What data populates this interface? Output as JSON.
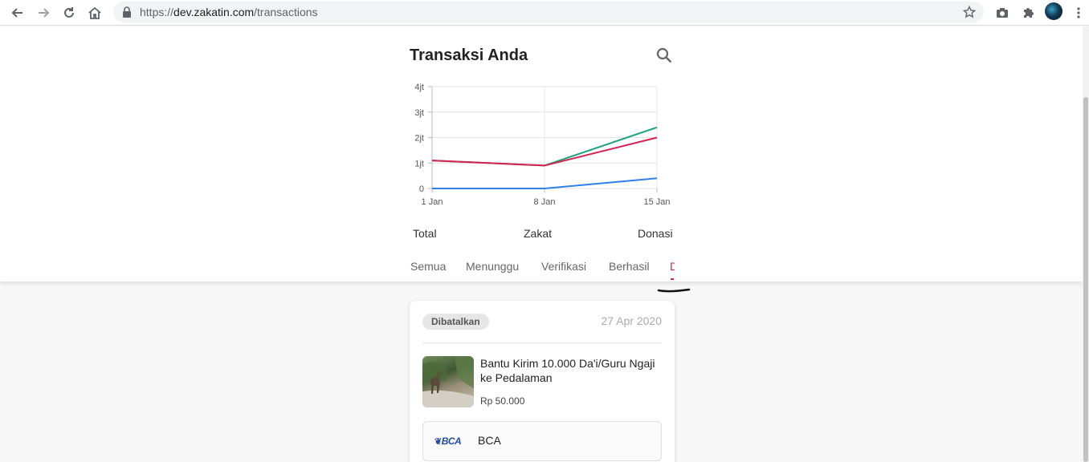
{
  "browser": {
    "url_scheme": "https://",
    "url_host": "dev.zakatin.com",
    "url_path": "/transactions"
  },
  "header": {
    "title": "Transaksi Anda"
  },
  "summary": {
    "labels": [
      "Total",
      "Zakat",
      "Donasi"
    ]
  },
  "tabs": [
    {
      "label": "Semua"
    },
    {
      "label": "Menunggu"
    },
    {
      "label": "Verifikasi"
    },
    {
      "label": "Berhasil"
    },
    {
      "label": "D"
    }
  ],
  "transaction": {
    "status": "Dibatalkan",
    "date": "27 Apr 2020",
    "title": "Bantu Kirim 10.000 Da'i/Guru Ngaji ke Pedalaman",
    "amount": "Rp 50.000",
    "bank_logo": "BCA",
    "bank_name": "BCA"
  },
  "colors": {
    "accent": "#d6204f",
    "series_total": "#1aa37a",
    "series_zakat": "#d6204f",
    "series_donasi": "#2f80ed"
  },
  "chart_data": {
    "type": "line",
    "x": [
      "1 Jan",
      "8 Jan",
      "15 Jan"
    ],
    "ylim": [
      0,
      4000000
    ],
    "y_ticks": [
      "0",
      "1jt",
      "2jt",
      "3jt",
      "4jt"
    ],
    "y_tick_values": [
      0,
      1000000,
      2000000,
      3000000,
      4000000
    ],
    "grid": true,
    "series": [
      {
        "values": [
          1100000,
          900000,
          2400000
        ],
        "color": "#1aa37a"
      },
      {
        "values": [
          1100000,
          900000,
          2000000
        ],
        "color": "#d6204f"
      },
      {
        "values": [
          0,
          0,
          400000
        ],
        "color": "#2f80ed"
      }
    ]
  }
}
